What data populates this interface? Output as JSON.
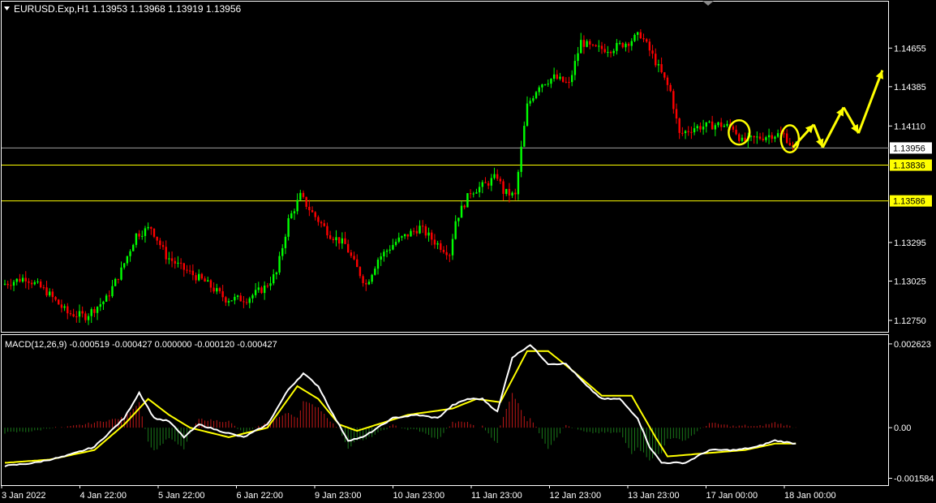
{
  "header": {
    "symbol_info": "EURUSD.Exp,H1  1.13953 1.13968 1.13919 1.13956",
    "indicator_info": "MACD(12,26,9) -0.000519 -0.000427 0.000000 -0.000120 -0.000427"
  },
  "colors": {
    "background": "#000000",
    "bull_candle": "#00ff00",
    "bear_candle": "#ff0000",
    "level_line": "#ffff00",
    "current_price_line": "#a0a0a0",
    "macd_line": "#ffffff",
    "signal_line": "#ffff00",
    "annotation": "#ffff00"
  },
  "chart_data": [
    {
      "type": "candlestick",
      "name": "price",
      "y_ticks": [
        "1.14655",
        "1.14385",
        "1.14110",
        "1.13295",
        "1.13025",
        "1.12750"
      ],
      "ylim": [
        1.1267,
        1.1498
      ],
      "current_price": "1.13956",
      "levels": [
        "1.13836",
        "1.13586"
      ],
      "x_labels": [
        "3 Jan 2022",
        "4 Jan 22:00",
        "5 Jan 22:00",
        "6 Jan 22:00",
        "9 Jan 23:00",
        "10 Jan 23:00",
        "11 Jan 23:00",
        "12 Jan 23:00",
        "13 Jan 23:00",
        "17 Jan 00:00",
        "18 Jan 00:00"
      ],
      "anchors": [
        [
          0,
          1.13
        ],
        [
          8,
          1.1305
        ],
        [
          15,
          1.1295
        ],
        [
          22,
          1.128
        ],
        [
          28,
          1.1278
        ],
        [
          35,
          1.129
        ],
        [
          40,
          1.131
        ],
        [
          45,
          1.1335
        ],
        [
          50,
          1.134
        ],
        [
          55,
          1.132
        ],
        [
          60,
          1.1312
        ],
        [
          68,
          1.1302
        ],
        [
          75,
          1.129
        ],
        [
          82,
          1.129
        ],
        [
          88,
          1.1298
        ],
        [
          92,
          1.1308
        ],
        [
          96,
          1.1345
        ],
        [
          100,
          1.1362
        ],
        [
          104,
          1.135
        ],
        [
          110,
          1.1335
        ],
        [
          115,
          1.1328
        ],
        [
          118,
          1.1315
        ],
        [
          122,
          1.13
        ],
        [
          126,
          1.1318
        ],
        [
          132,
          1.133
        ],
        [
          140,
          1.134
        ],
        [
          145,
          1.133
        ],
        [
          150,
          1.1322
        ],
        [
          152,
          1.1345
        ],
        [
          157,
          1.1365
        ],
        [
          162,
          1.137
        ],
        [
          166,
          1.1376
        ],
        [
          168,
          1.1365
        ],
        [
          172,
          1.1362
        ],
        [
          174,
          1.1395
        ],
        [
          176,
          1.1425
        ],
        [
          180,
          1.144
        ],
        [
          185,
          1.1445
        ],
        [
          190,
          1.144
        ],
        [
          194,
          1.147
        ],
        [
          198,
          1.1465
        ],
        [
          204,
          1.1465
        ],
        [
          210,
          1.147
        ],
        [
          214,
          1.1475
        ],
        [
          218,
          1.146
        ],
        [
          224,
          1.1435
        ],
        [
          227,
          1.1405
        ],
        [
          232,
          1.141
        ],
        [
          240,
          1.1412
        ],
        [
          245,
          1.141
        ],
        [
          248,
          1.14
        ],
        [
          252,
          1.1402
        ],
        [
          258,
          1.1405
        ],
        [
          262,
          1.1405
        ],
        [
          265,
          1.1396
        ]
      ],
      "bars": 266
    },
    {
      "type": "macd",
      "name": "MACD(12,26,9)",
      "y_ticks": [
        "0.002623",
        "0.00",
        "-0.001584"
      ],
      "ylim": [
        -0.0018,
        0.0029
      ],
      "macd": [
        [
          0,
          -0.0012
        ],
        [
          10,
          -0.0011
        ],
        [
          20,
          -0.0009
        ],
        [
          30,
          -0.0006
        ],
        [
          40,
          0.0003
        ],
        [
          45,
          0.0011
        ],
        [
          50,
          0.0003
        ],
        [
          55,
          0.0002
        ],
        [
          60,
          -0.0003
        ],
        [
          65,
          0.0001
        ],
        [
          72,
          -0.0001
        ],
        [
          80,
          -0.0003
        ],
        [
          88,
          0.0001
        ],
        [
          95,
          0.0012
        ],
        [
          100,
          0.0017
        ],
        [
          105,
          0.0013
        ],
        [
          110,
          0.0004
        ],
        [
          115,
          -0.0004
        ],
        [
          120,
          -0.0003
        ],
        [
          130,
          0.0003
        ],
        [
          138,
          0.0004
        ],
        [
          145,
          0.0003
        ],
        [
          150,
          0.0007
        ],
        [
          155,
          0.0009
        ],
        [
          160,
          0.0009
        ],
        [
          165,
          0.0005
        ],
        [
          170,
          0.0022
        ],
        [
          176,
          0.0026
        ],
        [
          182,
          0.002
        ],
        [
          188,
          0.002
        ],
        [
          195,
          0.0013
        ],
        [
          200,
          0.0009
        ],
        [
          206,
          0.0009
        ],
        [
          212,
          0.0003
        ],
        [
          216,
          -0.0006
        ],
        [
          220,
          -0.0011
        ],
        [
          228,
          -0.0011
        ],
        [
          236,
          -0.0007
        ],
        [
          245,
          -0.0007
        ],
        [
          252,
          -0.0006
        ],
        [
          258,
          -0.0004
        ],
        [
          265,
          -0.0005
        ]
      ],
      "signal": [
        [
          0,
          -0.0011
        ],
        [
          15,
          -0.001
        ],
        [
          30,
          -0.0007
        ],
        [
          40,
          0.0001
        ],
        [
          48,
          0.0009
        ],
        [
          55,
          0.0004
        ],
        [
          62,
          0.0
        ],
        [
          75,
          -0.0003
        ],
        [
          88,
          0.0
        ],
        [
          98,
          0.0013
        ],
        [
          105,
          0.0009
        ],
        [
          112,
          0.0001
        ],
        [
          118,
          -0.0001
        ],
        [
          135,
          0.0004
        ],
        [
          150,
          0.0006
        ],
        [
          158,
          0.0009
        ],
        [
          166,
          0.0008
        ],
        [
          175,
          0.0024
        ],
        [
          182,
          0.0024
        ],
        [
          190,
          0.0018
        ],
        [
          200,
          0.001
        ],
        [
          210,
          0.001
        ],
        [
          218,
          -0.0003
        ],
        [
          222,
          -0.0009
        ],
        [
          235,
          -0.0008
        ],
        [
          248,
          -0.0007
        ],
        [
          258,
          -0.0005
        ],
        [
          265,
          -0.0005
        ]
      ]
    }
  ],
  "annotations": {
    "ellipses": [
      {
        "bar": 246,
        "price": 1.14065,
        "price_span": 0.0017,
        "bar_span": 7
      },
      {
        "bar": 263,
        "price": 1.1402,
        "price_span": 0.0019,
        "bar_span": 6
      }
    ],
    "arrow_path": [
      [
        264,
        1.1396
      ],
      [
        271,
        1.1412
      ],
      [
        274,
        1.1396
      ],
      [
        281,
        1.1424
      ],
      [
        286,
        1.1406
      ],
      [
        294,
        1.145
      ]
    ]
  }
}
